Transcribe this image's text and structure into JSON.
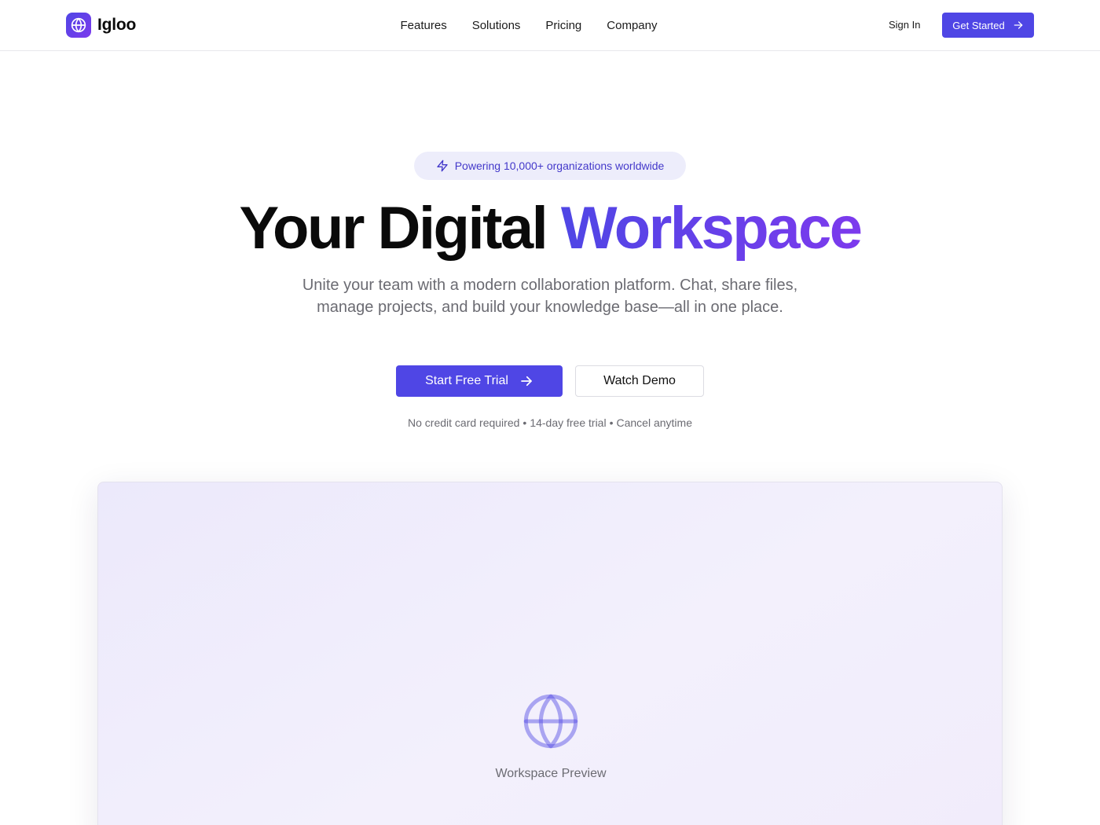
{
  "nav": {
    "brand_name": "Igloo",
    "links": [
      "Features",
      "Solutions",
      "Pricing",
      "Company"
    ],
    "sign_in_label": "Sign In",
    "get_started_label": "Get Started"
  },
  "hero": {
    "badge_text": "Powering 10,000+ organizations worldwide",
    "headline_part1": "Your Digital ",
    "headline_accent": "Workspace",
    "subheadline": "Unite your team with a modern collaboration platform. Chat, share files, manage projects, and build your knowledge base—all in one place.",
    "primary_cta": "Start Free Trial",
    "secondary_cta": "Watch Demo",
    "fineprint": [
      "No credit card required",
      "14-day free trial",
      "Cancel anytime"
    ],
    "fineprint_separator": "•"
  },
  "preview": {
    "label": "Workspace Preview"
  },
  "colors": {
    "accent": "#4f46e5",
    "accent_gradient_end": "#7c3aed",
    "badge_bg": "#ededfb",
    "muted_text": "#6b6b72"
  },
  "icons": {
    "brand_logo": "globe-icon",
    "badge": "lightning-icon",
    "cta_arrow": "arrow-right-icon",
    "preview": "globe-icon"
  }
}
